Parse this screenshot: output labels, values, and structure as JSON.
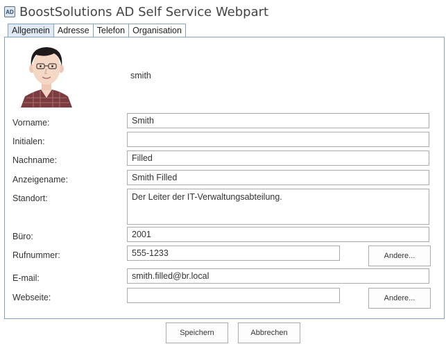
{
  "app": {
    "title": "BoostSolutions AD Self Service Webpart",
    "icon": "ad-app-icon",
    "icon_text": "AD"
  },
  "tabs": [
    {
      "label": "Allgemein",
      "active": true
    },
    {
      "label": "Adresse",
      "active": false
    },
    {
      "label": "Telefon",
      "active": false
    },
    {
      "label": "Organisation",
      "active": false
    }
  ],
  "profile": {
    "username": "smith",
    "photo": "user-avatar-photo"
  },
  "form": {
    "vorname": {
      "label": "Vorname:",
      "value": "Smith"
    },
    "initialen": {
      "label": "Initialen:",
      "value": ""
    },
    "nachname": {
      "label": "Nachname:",
      "value": "Filled"
    },
    "anzeigename": {
      "label": "Anzeigename:",
      "value": "Smith Filled"
    },
    "standort": {
      "label": "Standort:",
      "value": "Der Leiter der IT-Verwaltungsabteilung."
    },
    "buero": {
      "label": "Büro:",
      "value": "2001"
    },
    "rufnummer": {
      "label": "Rufnummer:",
      "value": "555-1233",
      "more_label": "Andere..."
    },
    "email": {
      "label": "E-mail:",
      "value": "smith.filled@br.local"
    },
    "webseite": {
      "label": "Webseite:",
      "value": "",
      "more_label": "Andere..."
    }
  },
  "actions": {
    "save_label": "Speichern",
    "cancel_label": "Abbrechen"
  },
  "colors": {
    "border": "#7fa3c2",
    "active_tab": "#dfe9f3",
    "field_border": "#ababab",
    "text": "#333333"
  }
}
